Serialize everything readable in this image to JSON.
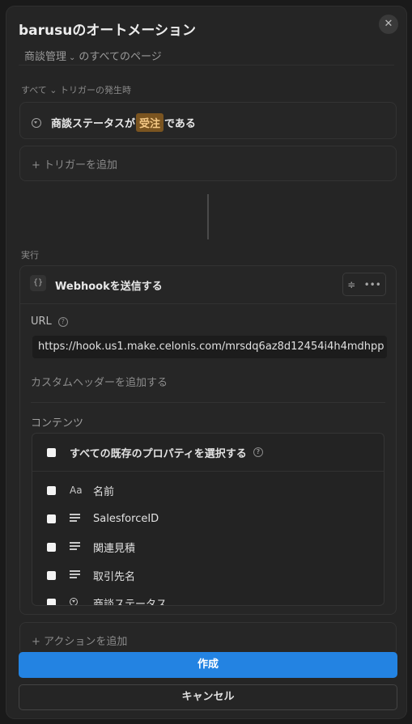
{
  "header": {
    "title": "barusuのオートメーション",
    "close_glyph": "✕",
    "db_name": "商談管理",
    "db_suffix": "のすべてのページ"
  },
  "trigger": {
    "section_label": "すべて ⌄ トリガーの発生時",
    "condition_prefix": "商談ステータスが",
    "condition_tag": "受注",
    "condition_suffix": "である",
    "add_trigger_label": "+ トリガーを追加"
  },
  "action": {
    "section_label": "実行",
    "icon_text": "{}",
    "title": "Webhookを送信する",
    "url_label": "URL",
    "url_value": "https://hook.us1.make.celonis.com/mrsdq6az8d12454i4h4mdhpp",
    "custom_header_label": "カスタムヘッダーを追加する",
    "content_label": "コンテンツ",
    "select_all_label": "すべての既存のプロパティを選択する",
    "properties": [
      {
        "icon": "text-type-icon",
        "icon_text": "Aa",
        "label": "名前"
      },
      {
        "icon": "lines-icon",
        "label": "SalesforceID"
      },
      {
        "icon": "lines-icon",
        "label": "関連見積"
      },
      {
        "icon": "lines-icon",
        "label": "取引先名"
      },
      {
        "icon": "status-icon",
        "label": "商談ステータス"
      }
    ],
    "add_action_label": "+ アクションを追加"
  },
  "footer": {
    "create_label": "作成",
    "cancel_label": "キャンセル"
  },
  "colors": {
    "primary": "#2383e2",
    "tag_bg": "#7a5420",
    "tag_text": "#f3c784"
  }
}
